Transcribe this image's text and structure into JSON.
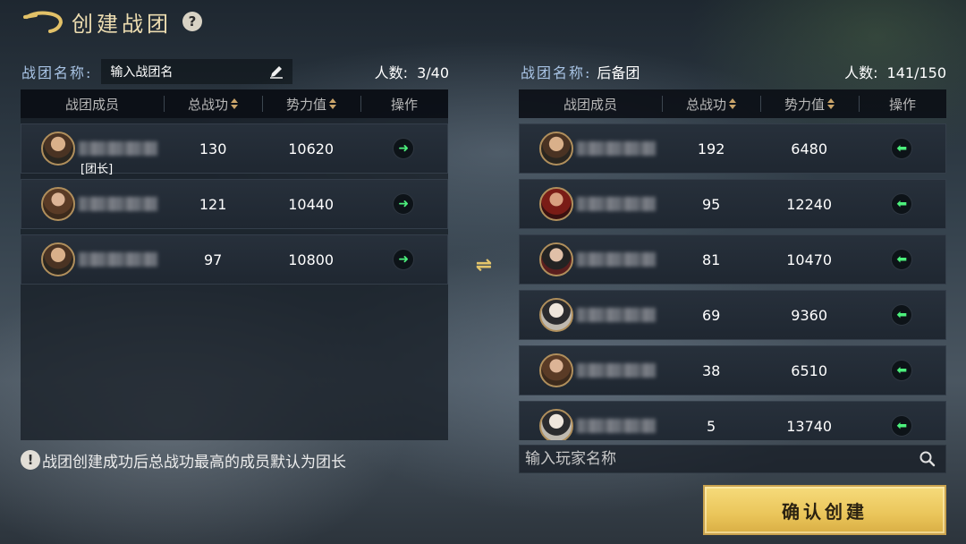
{
  "header": {
    "title": "创建战团",
    "back_icon": "back-arrow-icon",
    "help_label": "?"
  },
  "left": {
    "name_label": "战团名称:",
    "name_placeholder": "输入战团名",
    "count_label": "人数:",
    "count_value": "3/40",
    "columns": {
      "member": "战团成员",
      "merit": "总战功",
      "power": "势力值",
      "op": "操作"
    },
    "rows": [
      {
        "merit": "130",
        "power": "10620",
        "tag": "[团长]",
        "action": "move-right-arrow-icon"
      },
      {
        "merit": "121",
        "power": "10440",
        "tag": "",
        "action": "move-right-arrow-icon"
      },
      {
        "merit": "97",
        "power": "10800",
        "tag": "",
        "action": "move-right-arrow-icon"
      }
    ]
  },
  "right": {
    "name_label": "战团名称:",
    "squad_name": "后备团",
    "count_label": "人数:",
    "count_value": "141/150",
    "columns": {
      "member": "战团成员",
      "merit": "总战功",
      "power": "势力值",
      "op": "操作"
    },
    "rows": [
      {
        "merit": "192",
        "power": "6480",
        "action": "move-left-arrow-icon"
      },
      {
        "merit": "95",
        "power": "12240",
        "action": "move-left-arrow-icon"
      },
      {
        "merit": "81",
        "power": "10470",
        "action": "move-left-arrow-icon"
      },
      {
        "merit": "69",
        "power": "9360",
        "action": "move-left-arrow-icon"
      },
      {
        "merit": "38",
        "power": "6510",
        "action": "move-left-arrow-icon"
      },
      {
        "merit": "5",
        "power": "13740",
        "action": "move-left-arrow-icon"
      }
    ]
  },
  "hint": {
    "icon": "!",
    "text": "战团创建成功后总战功最高的成员默认为团长"
  },
  "search": {
    "placeholder": "输入玩家名称"
  },
  "confirm": {
    "label": "确认创建"
  },
  "colors": {
    "gold": "#e3c56b",
    "accent_blue": "#a8c3e4",
    "green_arrow": "#4cf07c"
  }
}
